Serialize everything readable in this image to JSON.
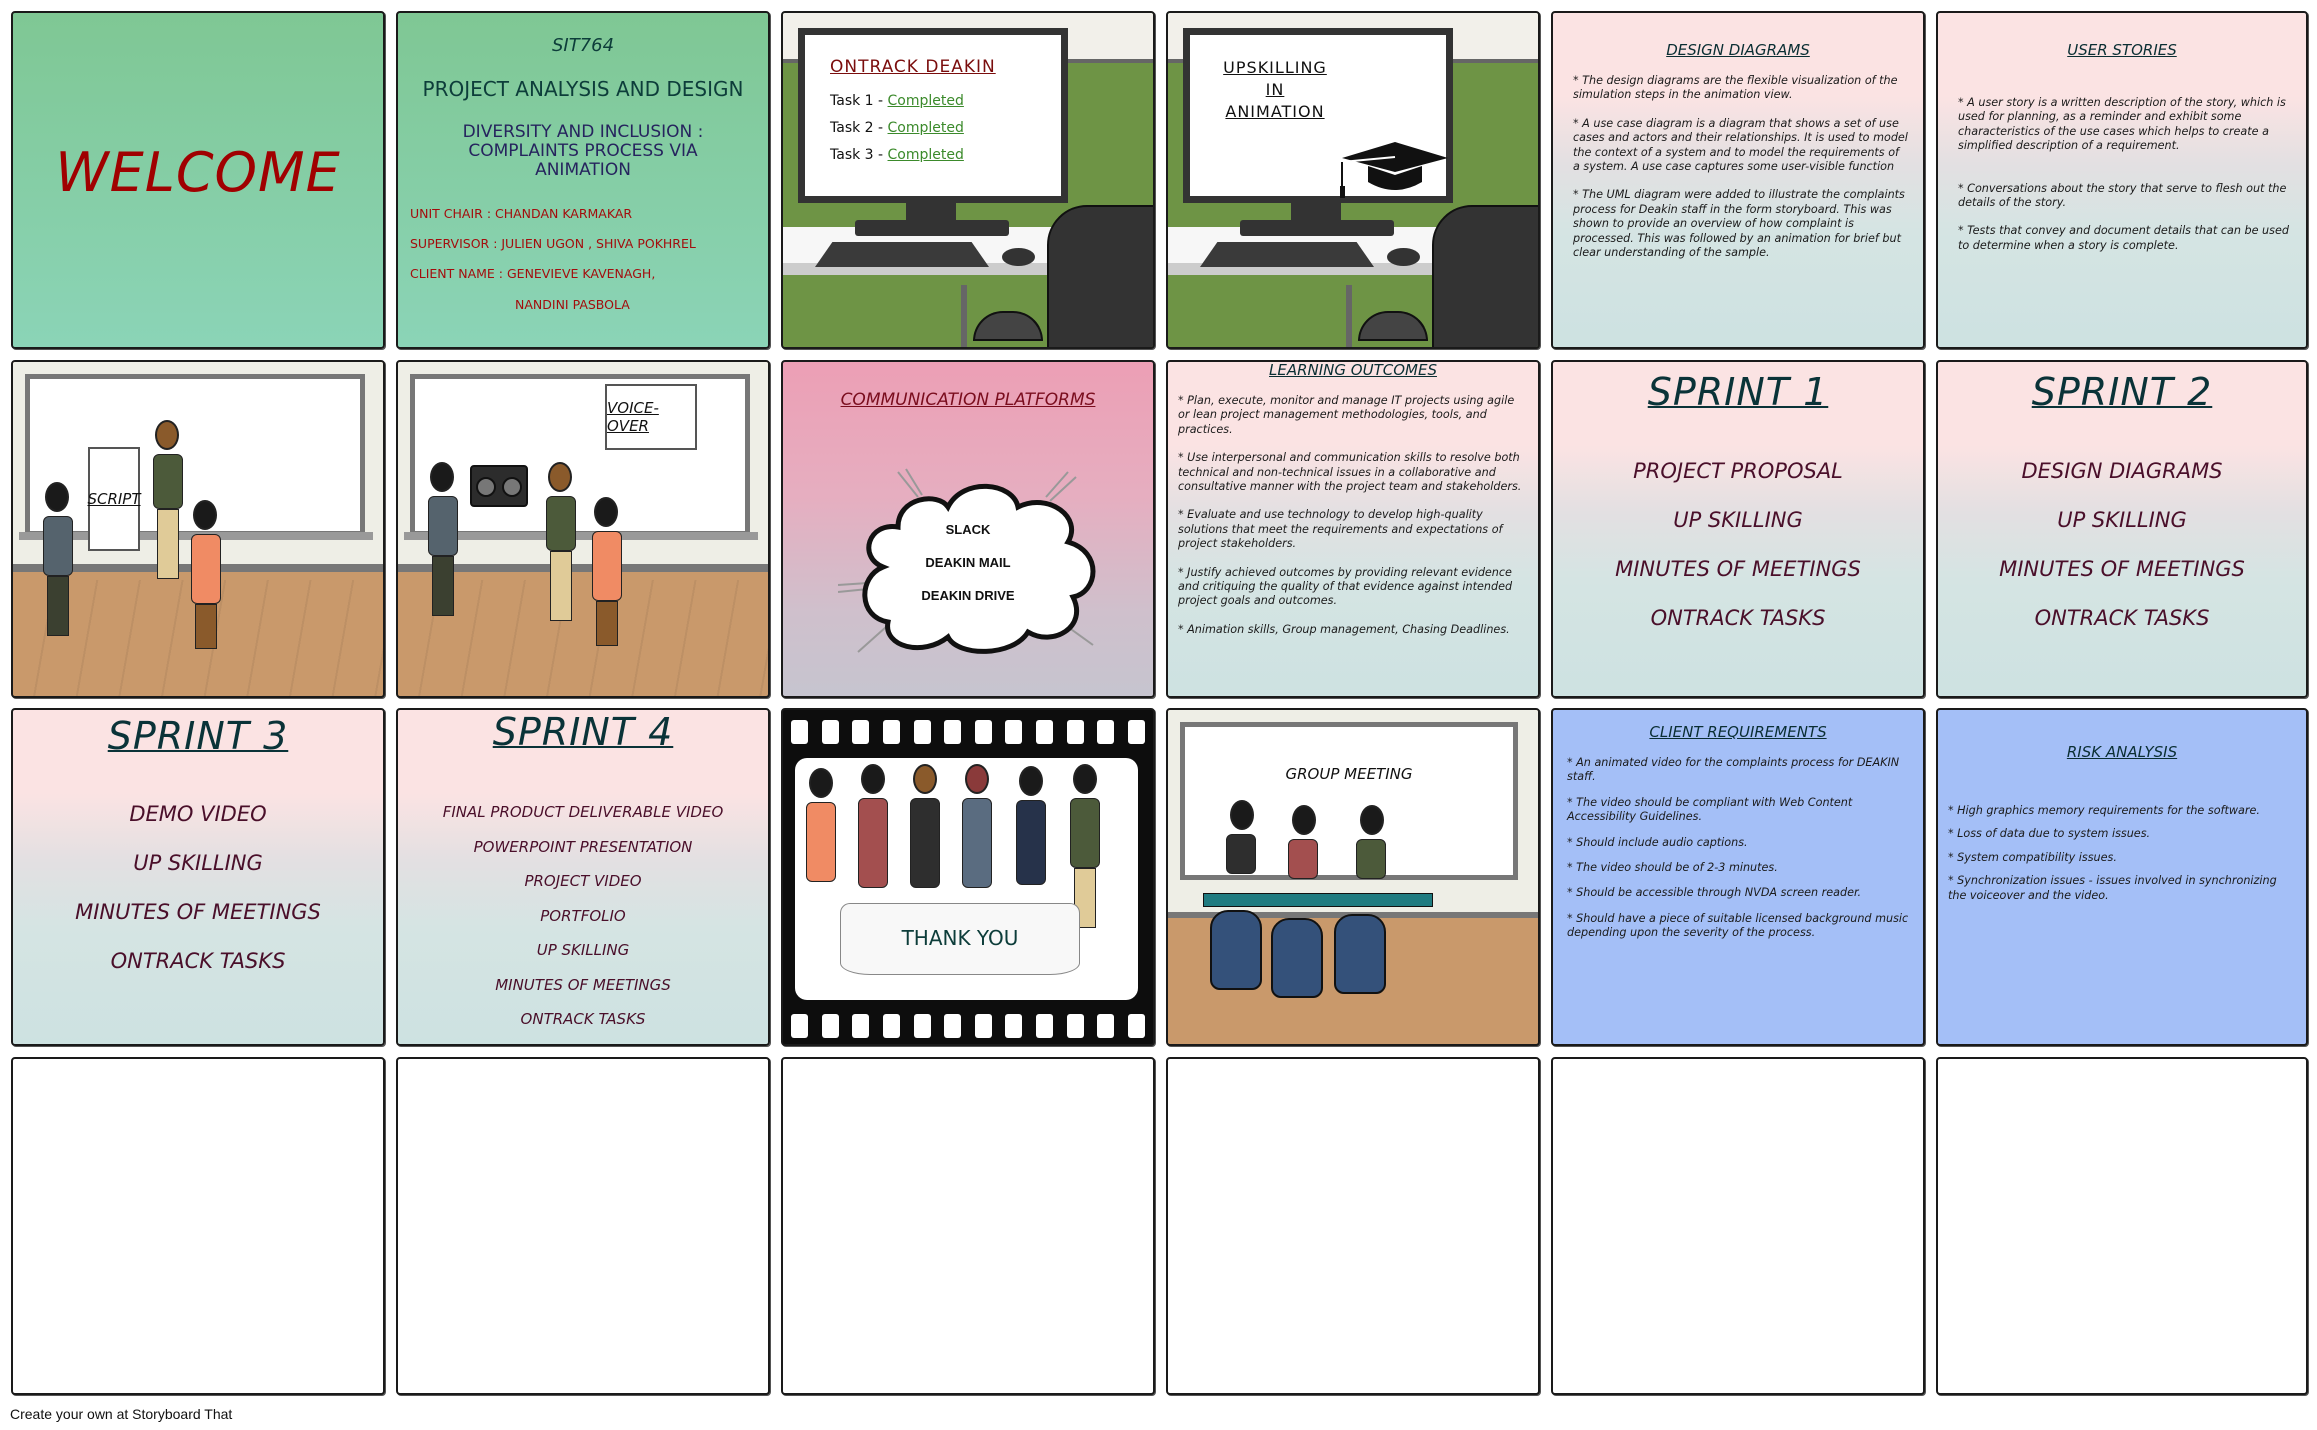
{
  "storyboard": {
    "footer_text": "Create your own at Storyboard That",
    "panels": {
      "welcome": {
        "title": "WELCOME",
        "title_color": "#a00000"
      },
      "project_info": {
        "course_code": "SIT764",
        "course_name": "PROJECT ANALYSIS AND DESIGN",
        "project_title": "DIVERSITY AND INCLUSION : COMPLAINTS PROCESS VIA ANIMATION",
        "unit_chair": "UNIT CHAIR : CHANDAN KARMAKAR",
        "supervisor": "SUPERVISOR : JULIEN UGON , SHIVA POKHREL",
        "client_name": "CLIENT NAME : GENEVIEVE KAVENAGH,",
        "client_name_2": "NANDINI PASBOLA"
      },
      "ontrack": {
        "title": "ONTRACK DEAKIN",
        "tasks": [
          {
            "label": "Task 1  - ",
            "status": "Completed"
          },
          {
            "label": "Task 2 - ",
            "status": "Completed"
          },
          {
            "label": "Task 3 - ",
            "status": "Completed"
          }
        ],
        "status_color": "#3b8a2b"
      },
      "upskilling": {
        "title_lines": [
          "UPSKILLING",
          "IN",
          "ANIMATION"
        ],
        "icon": "graduation-cap-icon"
      },
      "design_diagrams": {
        "heading": "DESIGN DIAGRAMS",
        "points": [
          "* The design diagrams are the flexible visualization of the simulation steps in the animation view.",
          "* A use case diagram is a diagram that shows a set of use cases and actors and their relationships. It is used to model the context of a system and to model the requirements of a system. A use case captures some user-visible function",
          "* The UML diagram were added to illustrate the complaints process for Deakin staff in the form storyboard. This was shown to provide an overview of how complaint is processed. This was followed by an animation for brief but clear understanding of the sample."
        ]
      },
      "user_stories": {
        "heading": "USER STORIES",
        "points": [
          "*  A user story is a written description of the story, which is used for planning, as a reminder and exhibit some characteristics of the use cases which helps to create a simplified description of a requirement.",
          "* Conversations about the story that serve to flesh out the details of the story.",
          "* Tests that convey and document details that can be used to determine when a story is complete."
        ]
      },
      "script": {
        "sign_label": "SCRIPT"
      },
      "voice_over": {
        "sign_label": "VOICE-OVER"
      },
      "communication": {
        "heading": "COMMUNICATION PLATFORMS",
        "platforms": [
          "SLACK",
          "DEAKIN MAIL",
          "DEAKIN DRIVE"
        ]
      },
      "learning_outcomes": {
        "heading": "LEARNING OUTCOMES",
        "points": [
          "* Plan, execute, monitor and manage IT projects using agile or lean project management methodologies, tools, and practices.",
          "* Use interpersonal and communication skills to resolve both technical and non-technical issues in a collaborative and consultative manner with the project team and stakeholders.",
          "* Evaluate and use technology to develop high-quality solutions that meet the requirements and expectations of project stakeholders.",
          "* Justify achieved outcomes by providing relevant evidence and critiquing the quality of that evidence against intended project goals and outcomes.",
          "* Animation skills, Group management, Chasing Deadlines."
        ]
      },
      "sprint1": {
        "title": "SPRINT 1",
        "items": [
          "PROJECT PROPOSAL",
          "UP SKILLING",
          "MINUTES OF MEETINGS",
          "ONTRACK TASKS"
        ]
      },
      "sprint2": {
        "title": "SPRINT 2",
        "items": [
          "DESIGN DIAGRAMS",
          "UP SKILLING",
          "MINUTES OF MEETINGS",
          "ONTRACK TASKS"
        ]
      },
      "sprint3": {
        "title": "SPRINT 3",
        "items": [
          "DEMO VIDEO",
          "UP SKILLING",
          "MINUTES OF MEETINGS",
          "ONTRACK TASKS"
        ]
      },
      "sprint4": {
        "title": "SPRINT 4",
        "items": [
          "FINAL PRODUCT DELIVERABLE VIDEO",
          "POWERPOINT PRESENTATION",
          "PROJECT VIDEO",
          "PORTFOLIO",
          "UP SKILLING",
          "MINUTES OF MEETINGS",
          "ONTRACK TASKS"
        ]
      },
      "thank_you": {
        "banner": "THANK YOU"
      },
      "group_meeting": {
        "board_text": "GROUP MEETING"
      },
      "client_requirements": {
        "heading": "CLIENT REQUIREMENTS",
        "points": [
          "* An animated video for the complaints process for DEAKIN staff.",
          "* The video should be compliant with Web Content Accessibility Guidelines.",
          "* Should include audio captions.",
          "* The video should be of 2-3 minutes.",
          "* Should be accessible through NVDA screen reader.",
          "* Should have a piece of suitable licensed background music depending upon the severity of the process."
        ]
      },
      "risk_analysis": {
        "heading": "RISK ANALYSIS",
        "points": [
          "* High graphics memory requirements for the software.",
          "* Loss of data due to system issues.",
          "* System compatibility issues.",
          "* Synchronization issues -  issues involved in synchronizing the voiceover and the video."
        ]
      }
    }
  }
}
